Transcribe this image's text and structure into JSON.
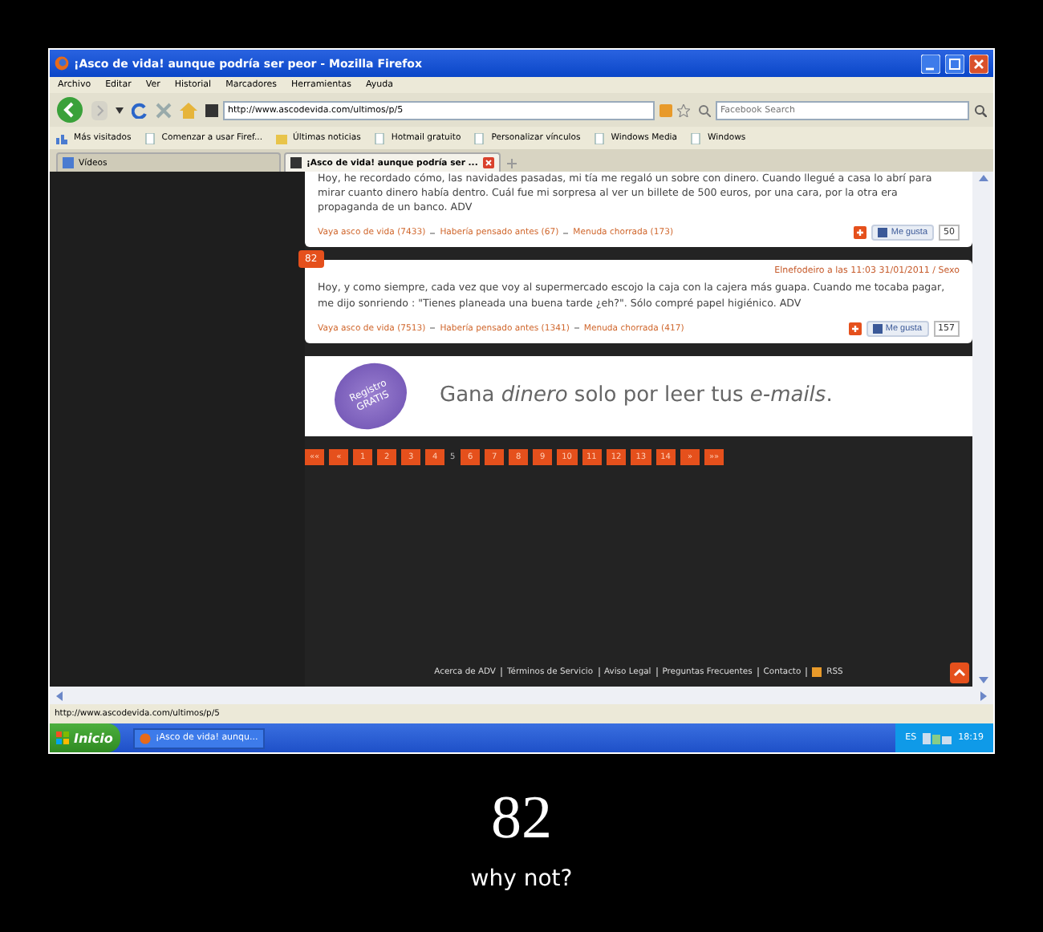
{
  "window": {
    "title": "¡Asco de vida! aunque podría ser peor - Mozilla Firefox"
  },
  "menu": [
    "Archivo",
    "Editar",
    "Ver",
    "Historial",
    "Marcadores",
    "Herramientas",
    "Ayuda"
  ],
  "address_bar": {
    "value": "http://www.ascodevida.com/ultimos/p/5"
  },
  "search": {
    "placeholder": "Facebook Search"
  },
  "bookmarks": [
    "Más visitados",
    "Comenzar a usar Firef...",
    "Últimas noticias",
    "Hotmail gratuito",
    "Personalizar vínculos",
    "Windows Media",
    "Windows"
  ],
  "tabs": [
    {
      "label": "Vídeos",
      "selected": false
    },
    {
      "label": "¡Asco de vida! aunque podría ser ...",
      "selected": true
    }
  ],
  "posts": [
    {
      "text": "Hoy, he recordado cómo, las navidades pasadas, mi tía me regaló un sobre con dinero. Cuando llegué a casa lo abrí para mirar cuanto dinero había dentro. Cuál fue mi sorpresa al ver un billete de 500 euros, por una cara, por la otra era propaganda de un banco. ADV",
      "votes": [
        "Vaya asco de vida (7433)",
        "Habería pensado antes (67)",
        "Menuda chorrada (173)"
      ],
      "like": "Me gusta",
      "like_count": "50"
    },
    {
      "number": "82",
      "meta": "Elnefodeiro a las 11:03 31/01/2011 / Sexo",
      "text": "Hoy, y como siempre, cada vez que voy al supermercado escojo la caja con la cajera más guapa. Cuando me tocaba pagar, me dijo sonriendo : \"Tienes planeada una buena tarde ¿eh?\". Sólo compré papel higiénico. ADV",
      "votes": [
        "Vaya asco de vida (7513)",
        "Habería pensado antes (1341)",
        "Menuda chorrada (417)"
      ],
      "like": "Me gusta",
      "like_count": "157"
    }
  ],
  "ad": {
    "badge": "Registro GRATIS",
    "text": "Gana *dinero* solo por leer tus *e-mails*."
  },
  "pagination": [
    {
      "label": "««",
      "selected": false
    },
    {
      "label": "«",
      "selected": false
    },
    {
      "label": "1",
      "selected": false
    },
    {
      "label": "2",
      "selected": false
    },
    {
      "label": "3",
      "selected": false
    },
    {
      "label": "4",
      "selected": false
    },
    {
      "label": "5",
      "selected": true
    },
    {
      "label": "6",
      "selected": false
    },
    {
      "label": "7",
      "selected": false
    },
    {
      "label": "8",
      "selected": false
    },
    {
      "label": "9",
      "selected": false
    },
    {
      "label": "10",
      "selected": false
    },
    {
      "label": "11",
      "selected": false
    },
    {
      "label": "12",
      "selected": false
    },
    {
      "label": "13",
      "selected": false
    },
    {
      "label": "14",
      "selected": false
    },
    {
      "label": "»",
      "selected": false
    },
    {
      "label": "»»",
      "selected": false
    }
  ],
  "footer_links": [
    "Acerca de ADV",
    "Términos de Servicio",
    "Aviso Legal",
    "Preguntas Frecuentes",
    "Contacto",
    "RSS"
  ],
  "status_bar": "http://www.ascodevida.com/ultimos/p/5",
  "taskbar": {
    "start": "Inicio",
    "task": "¡Asco de vida! aunqu...",
    "language": "ES",
    "time": "18:19"
  },
  "poster": {
    "title": "82",
    "caption": "why not?"
  }
}
